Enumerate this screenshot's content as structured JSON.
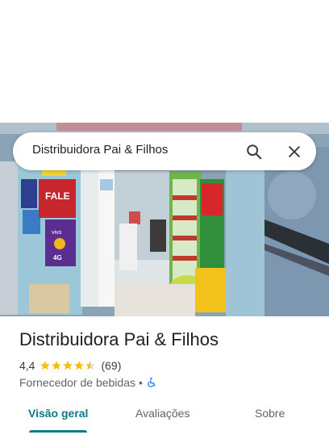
{
  "search": {
    "query": "Distribuidora Pai & Filhos"
  },
  "place": {
    "name": "Distribuidora Pai & Filhos",
    "rating": "4,4",
    "stars": 4.4,
    "review_count": "(69)",
    "category": "Fornecedor de bebidas",
    "separator": "•",
    "accessibility_icon": "wheelchair-icon"
  },
  "photo": {
    "signs": {
      "fale": "FALE",
      "vivo": "vivo",
      "g4": "4G"
    }
  },
  "tabs": [
    {
      "label": "Visão geral",
      "active": true
    },
    {
      "label": "Avaliações",
      "active": false
    },
    {
      "label": "Sobre",
      "active": false
    }
  ],
  "colors": {
    "accent": "#0b7a8a",
    "star": "#fbbc04"
  }
}
